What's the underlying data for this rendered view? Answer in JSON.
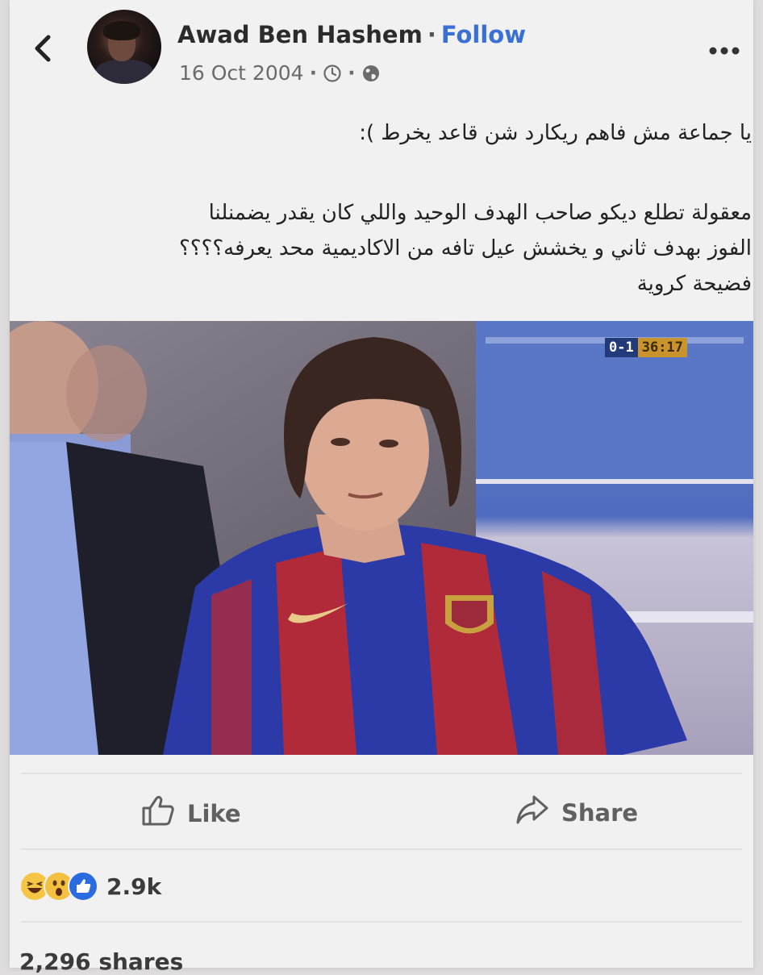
{
  "header": {
    "author_name": "Awad Ben Hashem",
    "separator": "·",
    "follow_label": "Follow",
    "date": "16 Oct 2004",
    "back_icon": "chevron-left-icon",
    "more_icon": "more-horizontal-icon",
    "clock_icon": "clock-icon",
    "globe_icon": "globe-icon"
  },
  "post": {
    "line1": "يا جماعة مش فاهم ريكارد شن قاعد يخرط ):",
    "paragraph": [
      "معقولة تطلع ديكو صاحب الهدف الوحيد واللي كان يقدر يضمنلنا",
      "الفوز بهدف ثاني و يخشش عيل تافه من الاكاديمية محد يعرفه؟؟؟؟",
      "فضيحة كروية"
    ]
  },
  "photo": {
    "score": "0-1",
    "clock": "36:17"
  },
  "actions": {
    "like_label": "Like",
    "share_label": "Share"
  },
  "stats": {
    "reaction_count": "2.9k",
    "shares": "2,296 shares",
    "reaction_icons": [
      "haha-reaction-icon",
      "wow-reaction-icon",
      "like-reaction-icon"
    ]
  },
  "colors": {
    "follow": "#3a6fd3",
    "like_reaction": "#2a6be0",
    "card_background": "#f2f1f1"
  }
}
